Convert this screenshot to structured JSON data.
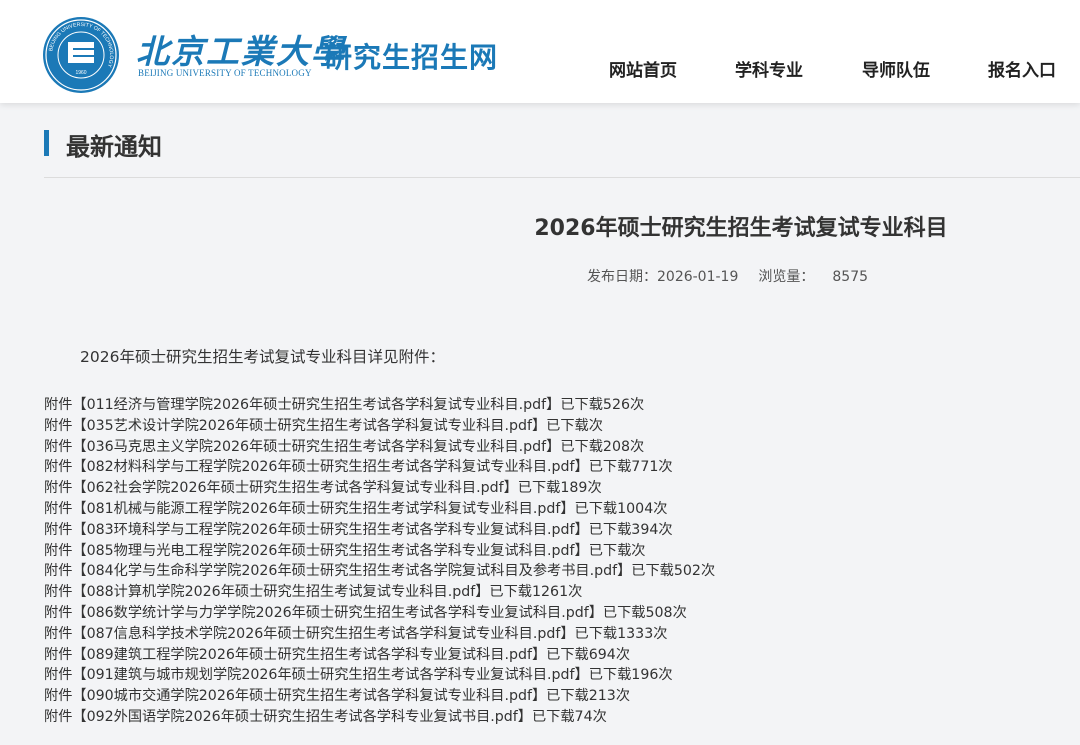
{
  "header": {
    "univ_name_cn": "北京工業大學",
    "univ_name_en": "BEIJING UNIVERSITY OF TECHNOLOGY",
    "site_name": "研究生招生网",
    "brand_color": "#1b79b7",
    "logo_icon": "university-seal-icon",
    "seal_text": "BEIJING UNIVERSITY OF TECHNOLOGY",
    "seal_year": "1960"
  },
  "nav": [
    {
      "label": "网站首页"
    },
    {
      "label": "学科专业"
    },
    {
      "label": "导师队伍"
    },
    {
      "label": "报名入口"
    }
  ],
  "section": {
    "title": "最新通知"
  },
  "article": {
    "title": "2026年硕士研究生招生考试复试专业科目",
    "date_label": "发布日期：",
    "date": "2026-01-19",
    "views_label": "浏览量：",
    "views": "8575",
    "intro": "2026年硕士研究生招生考试复试专业科目详见附件：",
    "attachments": [
      {
        "prefix": "附件【",
        "file": "011经济与管理学院2026年硕士研究生招生考试各学科复试专业科目.pdf",
        "suffix": "】已下载526次"
      },
      {
        "prefix": "附件【",
        "file": "035艺术设计学院2026年硕士研究生招生考试各学科复试专业科目.pdf",
        "suffix": "】已下载次"
      },
      {
        "prefix": "附件【",
        "file": "036马克思主义学院2026年硕士研究生招生考试各学科复试专业科目.pdf",
        "suffix": "】已下载208次"
      },
      {
        "prefix": "附件【",
        "file": "082材料科学与工程学院2026年硕士研究生招生考试各学科复试专业科目.pdf",
        "suffix": "】已下载771次"
      },
      {
        "prefix": "附件【",
        "file": "062社会学院2026年硕士研究生招生考试各学科复试专业科目.pdf",
        "suffix": "】已下载189次"
      },
      {
        "prefix": "附件【",
        "file": "081机械与能源工程学院2026年硕士研究生招生考试学科复试专业科目.pdf",
        "suffix": "】已下载1004次"
      },
      {
        "prefix": "附件【",
        "file": "083环境科学与工程学院2026年硕士研究生招生考试各学科专业复试科目.pdf",
        "suffix": "】已下载394次"
      },
      {
        "prefix": "附件【",
        "file": "085物理与光电工程学院2026年硕士研究生招生考试各学科专业复试科目.pdf",
        "suffix": "】已下载次"
      },
      {
        "prefix": "附件【",
        "file": "084化学与生命科学学院2026年硕士研究生招生考试各学院复试科目及参考书目.pdf",
        "suffix": "】已下载502次"
      },
      {
        "prefix": "附件【",
        "file": "088计算机学院2026年硕士研究生招生考试复试专业科目.pdf",
        "suffix": "】已下载1261次"
      },
      {
        "prefix": "附件【",
        "file": "086数学统计学与力学学院2026年硕士研究生招生考试各学科专业复试科目.pdf",
        "suffix": "】已下载508次"
      },
      {
        "prefix": "附件【",
        "file": "087信息科学技术学院2026年硕士研究生招生考试各学科复试专业科目.pdf",
        "suffix": "】已下载1333次"
      },
      {
        "prefix": "附件【",
        "file": "089建筑工程学院2026年硕士研究生招生考试各学科专业复试科目.pdf",
        "suffix": "】已下载694次"
      },
      {
        "prefix": "附件【",
        "file": "091建筑与城市规划学院2026年硕士研究生招生考试各学科专业复试科目.pdf",
        "suffix": "】已下载196次"
      },
      {
        "prefix": "附件【",
        "file": "090城市交通学院2026年硕士研究生招生考试各学科复试专业科目.pdf",
        "suffix": "】已下载213次"
      },
      {
        "prefix": "附件【",
        "file": "092外国语学院2026年硕士研究生招生考试各学科专业复试书目.pdf",
        "suffix": "】已下载74次"
      }
    ]
  }
}
